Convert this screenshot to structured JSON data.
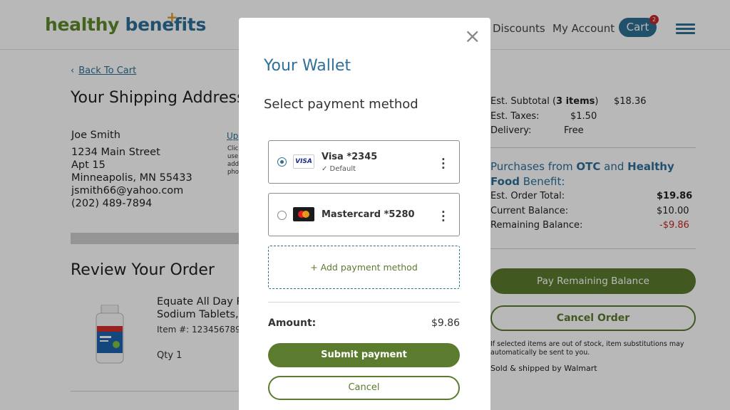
{
  "header": {
    "logo_word1": "healthy",
    "logo_word2": "benefits",
    "logo_plus": "+",
    "nav": [
      "Discounts",
      "My Account"
    ],
    "cart_label": "Cart",
    "cart_count": "2"
  },
  "left": {
    "back_label": "Back To Cart",
    "back_chevron": "‹",
    "shipping_title": "Your Shipping Address",
    "address_lines": [
      "Joe Smith",
      "1234 Main Street",
      "Apt 15",
      "Minneapolis, MN 55433",
      "jsmith66@yahoo.com",
      "(202) 489-7894"
    ],
    "update_link": "Up",
    "note_lines": [
      "Clic",
      "use",
      "add",
      "pho"
    ],
    "review_title": "Review Your Order",
    "product_name_lines": [
      "Equate All Day P",
      "Sodium Tablets, "
    ],
    "product_item": "Item #: 123456789",
    "product_qty": "Qty 1"
  },
  "summary": {
    "subtotal_label_pre": "Est. Subtotal (",
    "subtotal_items": "3 items",
    "subtotal_label_post": ")",
    "subtotal_value": "$18.36",
    "taxes_label": "Est. Taxes:",
    "taxes_value": "$1.50",
    "delivery_label": "Delivery:",
    "delivery_value": "Free",
    "purchases_pre": "Purchases from ",
    "purchases_otc": "OTC",
    "purchases_and": " and ",
    "purchases_hf": "Healthy Food",
    "purchases_post": " Benefit:",
    "order_total_label": "Est. Order Total:",
    "order_total_value": "$19.86",
    "current_balance_label": "Current Balance:",
    "current_balance_value": "$10.00",
    "remaining_label": "Remaining Balance:",
    "remaining_value": "-$9.86",
    "pay_remaining": "Pay Remaining Balance",
    "cancel_order": "Cancel Order",
    "oos_note": "If selected items are out of stock, item substitutions may automatically be sent to you.",
    "sold_note": "Sold & shipped by Walmart"
  },
  "modal": {
    "close": "×",
    "title": "Your Wallet",
    "subtitle": "Select payment method",
    "methods": [
      {
        "brand": "VISA",
        "name": "Visa *2345",
        "default_label": "✓ Default",
        "selected": true
      },
      {
        "brand": "mastercard",
        "name": "Mastercard *5280",
        "selected": false
      }
    ],
    "kebab": "⋮",
    "add_method": "+ Add payment method",
    "amount_label": "Amount:",
    "amount_value": "$9.86",
    "submit": "Submit payment",
    "cancel": "Cancel"
  },
  "colors": {
    "brand_green": "#5b7b2e",
    "brand_blue": "#2e7099",
    "negative_red": "#c62828"
  }
}
